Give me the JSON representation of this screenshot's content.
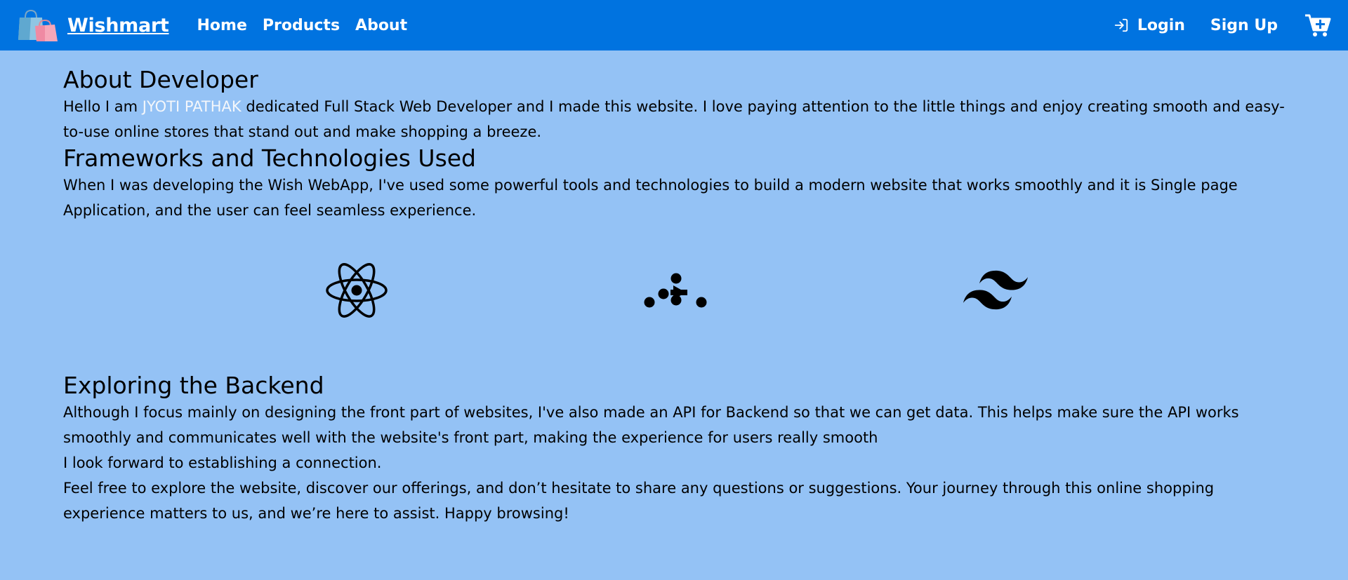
{
  "nav": {
    "brand": "Wishmart",
    "links": [
      "Home",
      "Products",
      "About"
    ],
    "login": "Login",
    "signup": "Sign Up",
    "logo_icon": "shopping-bags-icon",
    "cart_icon": "cart-plus-icon"
  },
  "about": {
    "title": "About Developer",
    "intro_before": "Hello I am ",
    "name": "JYOTI PATHAK",
    "intro_after": " dedicated Full Stack Web Developer and I made this website. I love paying attention to the little things and enjoy creating smooth and easy-to-use online stores that stand out and make shopping a breeze."
  },
  "frameworks": {
    "title": "Frameworks and Technologies Used",
    "text": "When I was developing the Wish WebApp, I've used some powerful tools and technologies to build a modern website that works smoothly and it is Single page Application, and the user can feel seamless experience.",
    "icons": [
      "react-icon",
      "redux-icon",
      "tailwind-icon"
    ]
  },
  "backend": {
    "title": "Exploring the Backend",
    "p1": "Although I focus mainly on designing the front part of websites, I've also made an API for Backend so that we can get data. This helps make sure the API works smoothly and communicates well with the website's front part, making the experience for users really smooth",
    "p2": "I look forward to establishing a connection.",
    "p3": "Feel free to explore the website, discover our offerings, and don’t hesitate to share any questions or suggestions. Your journey through this online shopping experience matters to us, and we’re here to assist. Happy browsing!"
  },
  "colors": {
    "navbar": "#0073e0",
    "background": "#94c2f5",
    "highlight": "#f4f7fb"
  }
}
